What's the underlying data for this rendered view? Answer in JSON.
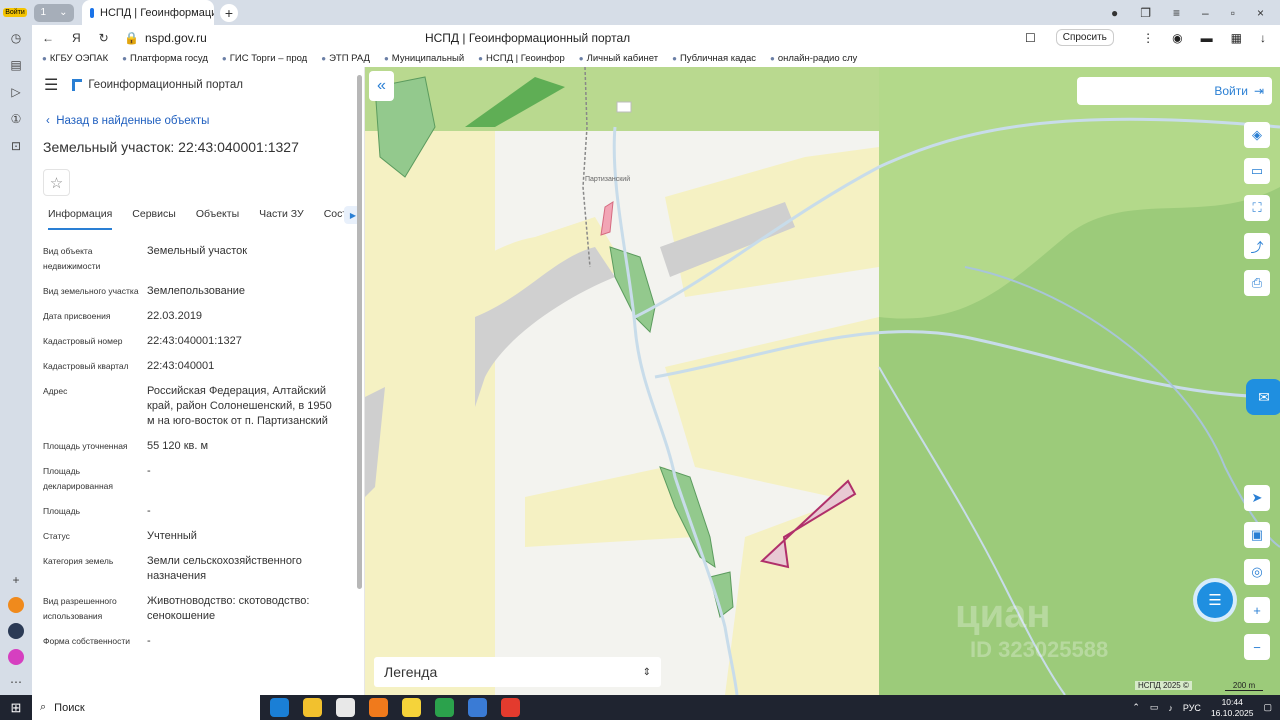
{
  "browser": {
    "logo_badge": "Войти",
    "group_count": "1",
    "tab_title": "НСПД | Геоинформаци",
    "url": "nspd.gov.ru",
    "page_title": "НСПД | Геоинформационный портал",
    "ask_label": "Спросить",
    "bookmarks": [
      "КГБУ ОЭПАК",
      "Платформа госуд",
      "ГИС Торги – прод",
      "ЭТП РАД",
      "Муниципальный",
      "НСПД | Геоинфор",
      "Личный кабинет",
      "Публичная кадас",
      "онлайн-радио слу"
    ]
  },
  "portal": {
    "name": "Геоинформационный портал",
    "back_link": "Назад в найденные объекты",
    "object_title": "Земельный участок: 22:43:040001:1327",
    "tabs": [
      "Информация",
      "Сервисы",
      "Объекты",
      "Части ЗУ",
      "Соста"
    ],
    "properties": [
      {
        "key": "Вид объекта недвижимости",
        "value": "Земельный участок"
      },
      {
        "key": "Вид земельного участка",
        "value": "Землепользование"
      },
      {
        "key": "Дата присвоения",
        "value": "22.03.2019"
      },
      {
        "key": "Кадастровый номер",
        "value": "22:43:040001:1327"
      },
      {
        "key": "Кадастровый квартал",
        "value": "22:43:040001"
      },
      {
        "key": "Адрес",
        "value": "Российская Федерация, Алтайский край, район Солонешенский, в 1950 м на юго-восток от п. Партизанский"
      },
      {
        "key": "Площадь уточненная",
        "value": "55 120 кв. м"
      },
      {
        "key": "Площадь декларированная",
        "value": "-"
      },
      {
        "key": "Площадь",
        "value": "-"
      },
      {
        "key": "Статус",
        "value": "Учтенный"
      },
      {
        "key": "Категория земель",
        "value": "Земли сельскохозяйственного назначения"
      },
      {
        "key": "Вид разрешенного использования",
        "value": "Животноводство: скотоводство: сенокошение"
      },
      {
        "key": "Форма собственности",
        "value": "-"
      }
    ]
  },
  "map": {
    "login_label": "Войти",
    "place_label": "Партизанский",
    "legend_label": "Легенда",
    "copyright": "НСПД 2025 ©",
    "scale_label": "200 m",
    "watermark": "циан",
    "watermark_id": "ID 323025588",
    "colors": {
      "forest": "#a9cf8a",
      "field": "#f5f1c3",
      "base": "#f2f2f0",
      "parcel": "#e8c9d3",
      "parcel_border": "#b0306a",
      "river": "#c8dcea",
      "road": "#cfcfcf"
    }
  },
  "taskbar": {
    "search_label": "Поиск",
    "lang": "РУС",
    "time": "10:44",
    "date": "16.10.2025"
  }
}
